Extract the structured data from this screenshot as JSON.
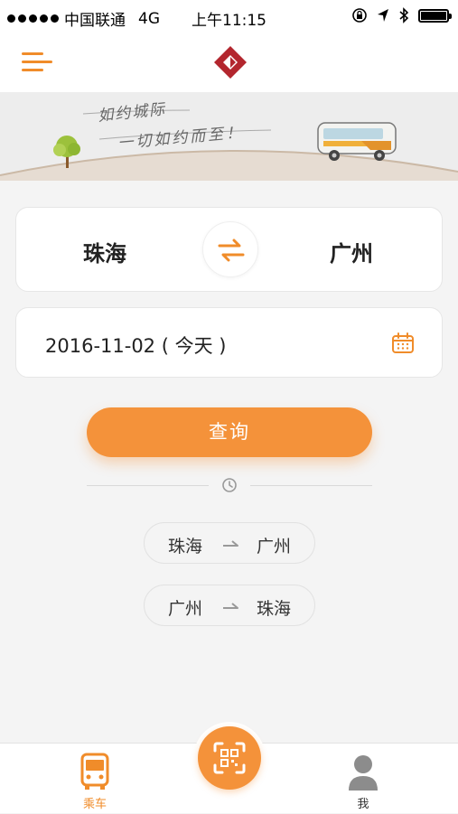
{
  "status_bar": {
    "carrier": "中国联通",
    "network": "4G",
    "time": "上午11:15"
  },
  "nav": {
    "menu_icon": "hamburger-menu-icon",
    "logo_icon": "brand-diamond-logo"
  },
  "banner": {
    "slogan_line1": "如约城际",
    "slogan_line2": "一切如约而至！"
  },
  "route": {
    "from": "珠海",
    "to": "广州",
    "swap_icon": "swap-arrows-icon"
  },
  "date": {
    "value": "2016-11-02 ( 今天 )",
    "calendar_icon": "calendar-icon"
  },
  "query_button": {
    "label": "查询"
  },
  "history": {
    "icon": "clock-icon",
    "items": [
      {
        "from": "珠海",
        "to": "广州"
      },
      {
        "from": "广州",
        "to": "珠海"
      }
    ]
  },
  "tab_bar": {
    "ride_label": "乘车",
    "me_label": "我",
    "scan_icon": "qr-scan-icon"
  },
  "colors": {
    "accent": "#f4923a",
    "logo_red": "#b3262e",
    "background": "#f4f4f4"
  }
}
